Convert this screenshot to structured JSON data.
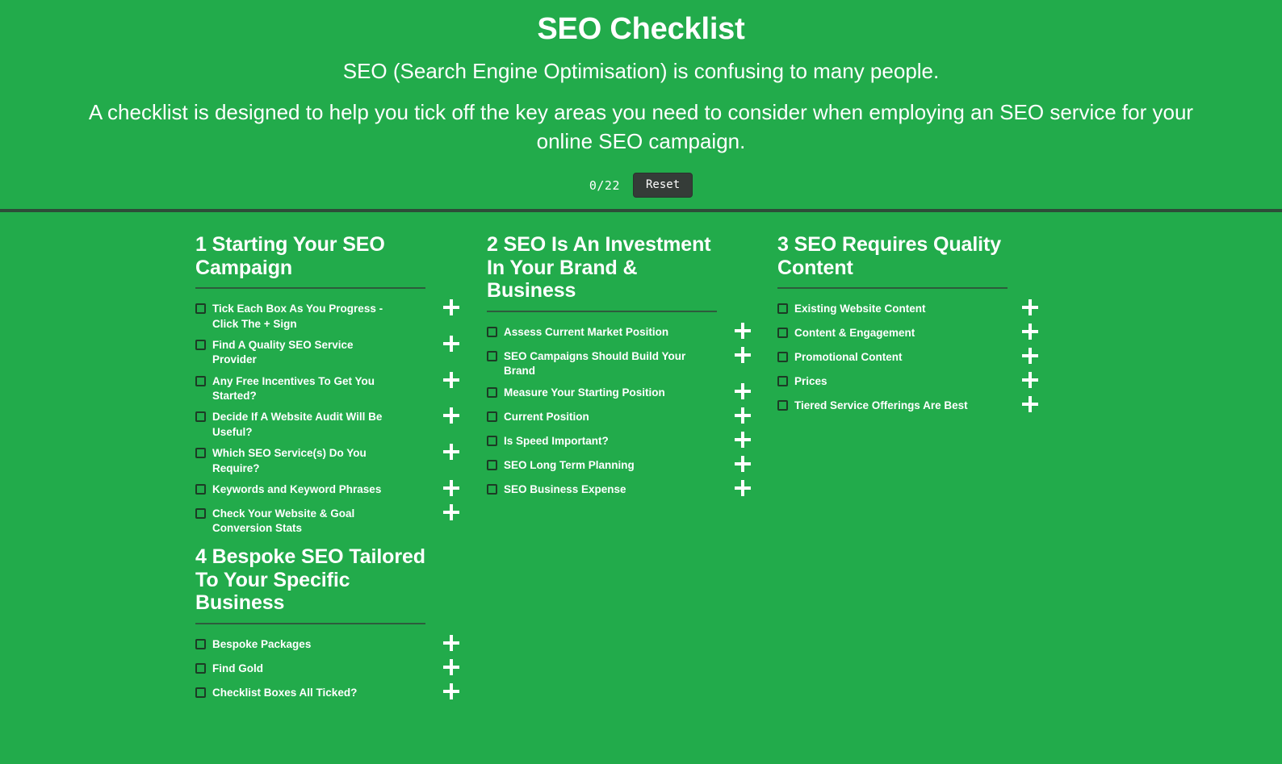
{
  "header": {
    "title": "SEO Checklist",
    "intro_line_1": "SEO (Search Engine Optimisation) is confusing to many people.",
    "intro_line_2": "A checklist is designed to help you tick off the key areas you need to consider when employing an SEO service for your online SEO campaign.",
    "counter": "0/22",
    "reset_label": "Reset"
  },
  "colors": {
    "background": "#22ab4b",
    "divider": "#2d4c38",
    "section_rule": "#2d5c3c",
    "checkbox_border": "#1c3b25",
    "reset_button": "#353c38",
    "text": "#ffffff"
  },
  "icons": {
    "add": "plus-icon"
  },
  "sections": [
    {
      "number": "1",
      "title": "1 Starting Your SEO Campaign",
      "items": [
        {
          "label": "Tick Each Box As You Progress - Click The + Sign",
          "checked": false
        },
        {
          "label": "Find A Quality SEO Service Provider",
          "checked": false
        },
        {
          "label": "Any Free Incentives To Get You Started?",
          "checked": false
        },
        {
          "label": "Decide If A Website Audit Will Be Useful?",
          "checked": false
        },
        {
          "label": "Which SEO Service(s) Do You Require?",
          "checked": false
        },
        {
          "label": "Keywords and Keyword Phrases",
          "checked": false
        },
        {
          "label": "Check Your Website & Goal Conversion Stats",
          "checked": false
        }
      ]
    },
    {
      "number": "2",
      "title": "2 SEO Is An Investment In Your Brand & Business",
      "items": [
        {
          "label": "Assess Current Market Position",
          "checked": false
        },
        {
          "label": "SEO Campaigns Should Build Your Brand",
          "checked": false
        },
        {
          "label": "Measure Your Starting Position",
          "checked": false
        },
        {
          "label": "Current Position",
          "checked": false
        },
        {
          "label": "Is Speed Important?",
          "checked": false
        },
        {
          "label": "SEO Long Term Planning",
          "checked": false
        },
        {
          "label": "SEO Business Expense",
          "checked": false
        }
      ]
    },
    {
      "number": "3",
      "title": "3 SEO Requires Quality Content",
      "items": [
        {
          "label": "Existing Website Content",
          "checked": false
        },
        {
          "label": "Content & Engagement",
          "checked": false
        },
        {
          "label": "Promotional Content",
          "checked": false
        },
        {
          "label": "Prices",
          "checked": false
        },
        {
          "label": "Tiered Service Offerings Are Best",
          "checked": false
        }
      ]
    },
    {
      "number": "4",
      "title": "4 Bespoke SEO Tailored To Your Specific Business",
      "items": [
        {
          "label": "Bespoke Packages",
          "checked": false
        },
        {
          "label": "Find Gold",
          "checked": false
        },
        {
          "label": "Checklist Boxes All Ticked?",
          "checked": false
        }
      ]
    }
  ]
}
